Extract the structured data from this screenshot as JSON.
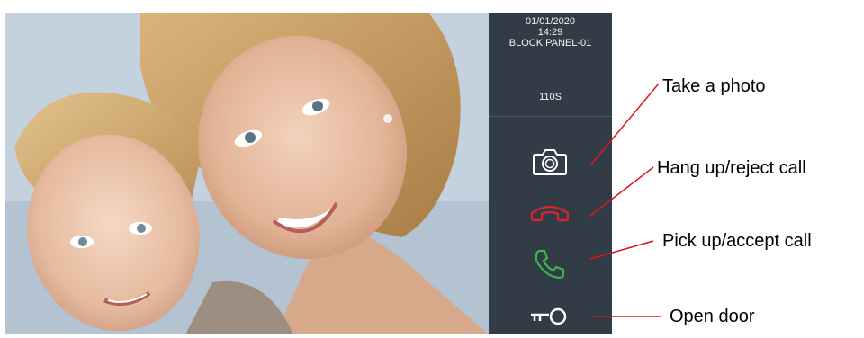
{
  "intercom": {
    "date": "01/01/2020",
    "time": "14:29",
    "panel_name": "BLOCK PANEL-01",
    "call_timer": "110S"
  },
  "video": {
    "description_icon": "camera-feed"
  },
  "controls": {
    "photo": {
      "icon": "camera-icon",
      "color": "#ffffff"
    },
    "hangup": {
      "icon": "phone-hangup-icon",
      "color": "#e0222a"
    },
    "answer": {
      "icon": "phone-answer-icon",
      "color": "#3cb54a"
    },
    "door": {
      "icon": "key-icon",
      "color": "#ffffff"
    }
  },
  "callouts": {
    "photo": "Take a photo",
    "hangup": "Hang up/reject call",
    "answer": "Pick up/accept call",
    "door": "Open door",
    "line_color": "#e0141e"
  },
  "colors": {
    "panel_background": "#323c46"
  }
}
